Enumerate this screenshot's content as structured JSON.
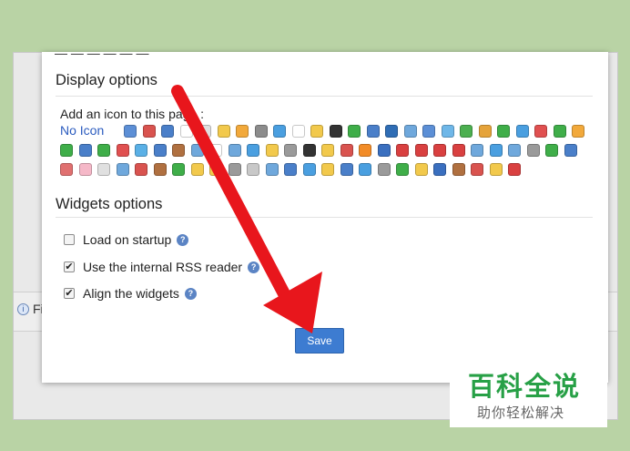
{
  "background_page": {
    "strip_label": "Fi"
  },
  "dialog": {
    "display_options": {
      "title": "Display options",
      "icon_prompt": "Add an icon to this page :",
      "no_icon_label": "No Icon",
      "icon_colors": [
        "#5c8fd6",
        "#d9534f",
        "#4a7fc9",
        "#ffffff",
        "#e0e0e0",
        "#f2c94c",
        "#f2a93b",
        "#8c8c8c",
        "#4a9fe0",
        "#ffffff",
        "#f2c94c",
        "#333333",
        "#3fae49",
        "#4a7fc9",
        "#2f6db5",
        "#6fa8dc",
        "#5c8fd6",
        "#6fb7e8",
        "#4caf50",
        "#e5a33a",
        "#3fae49",
        "#4a9fe0",
        "#e05050",
        "#3fae49",
        "#f2a93b",
        "#3fae49",
        "#4a7fc9",
        "#3fae49",
        "#e05050",
        "#5ab0e6",
        "#4a7fc9",
        "#b07040",
        "#6fa8dc",
        "#ffffff",
        "#6fa8dc",
        "#4a9fe0",
        "#f2c94c",
        "#9a9a9a",
        "#333333",
        "#f2c94c",
        "#d9534f",
        "#f28c28",
        "#3a6fbf",
        "#d94040",
        "#d94040",
        "#d94040",
        "#d94040",
        "#6fa8dc",
        "#4a9fe0",
        "#6fa8dc",
        "#9a9a9a",
        "#3fae49",
        "#4a7fc9",
        "#e07070",
        "#f5b8c8",
        "#e0e0e0",
        "#6fa8dc",
        "#d9534f",
        "#b07040",
        "#3fae49",
        "#f2c94c",
        "#f2c94c",
        "#9a9a9a",
        "#c8c8c8",
        "#6fa8dc",
        "#4a7fc9",
        "#4a9fe0",
        "#f2c94c",
        "#4a7fc9",
        "#4a9fe0",
        "#9a9a9a",
        "#3fae49",
        "#f2c94c",
        "#3a6fbf",
        "#b07040",
        "#d9534f",
        "#f2c94c",
        "#d94040"
      ]
    },
    "widgets_options": {
      "title": "Widgets options",
      "items": [
        {
          "label": "Load on startup",
          "checked": false
        },
        {
          "label": "Use the internal RSS reader",
          "checked": true
        },
        {
          "label": "Align the widgets",
          "checked": true
        }
      ]
    },
    "save_label": "Save"
  },
  "colors": {
    "arrow": "#e8161c",
    "save_button": "#3d7cd1",
    "link": "#2a5bbf",
    "watermark_green": "#27a046"
  },
  "watermark": {
    "title": "百科全说",
    "subtitle": "助你轻松解决"
  }
}
